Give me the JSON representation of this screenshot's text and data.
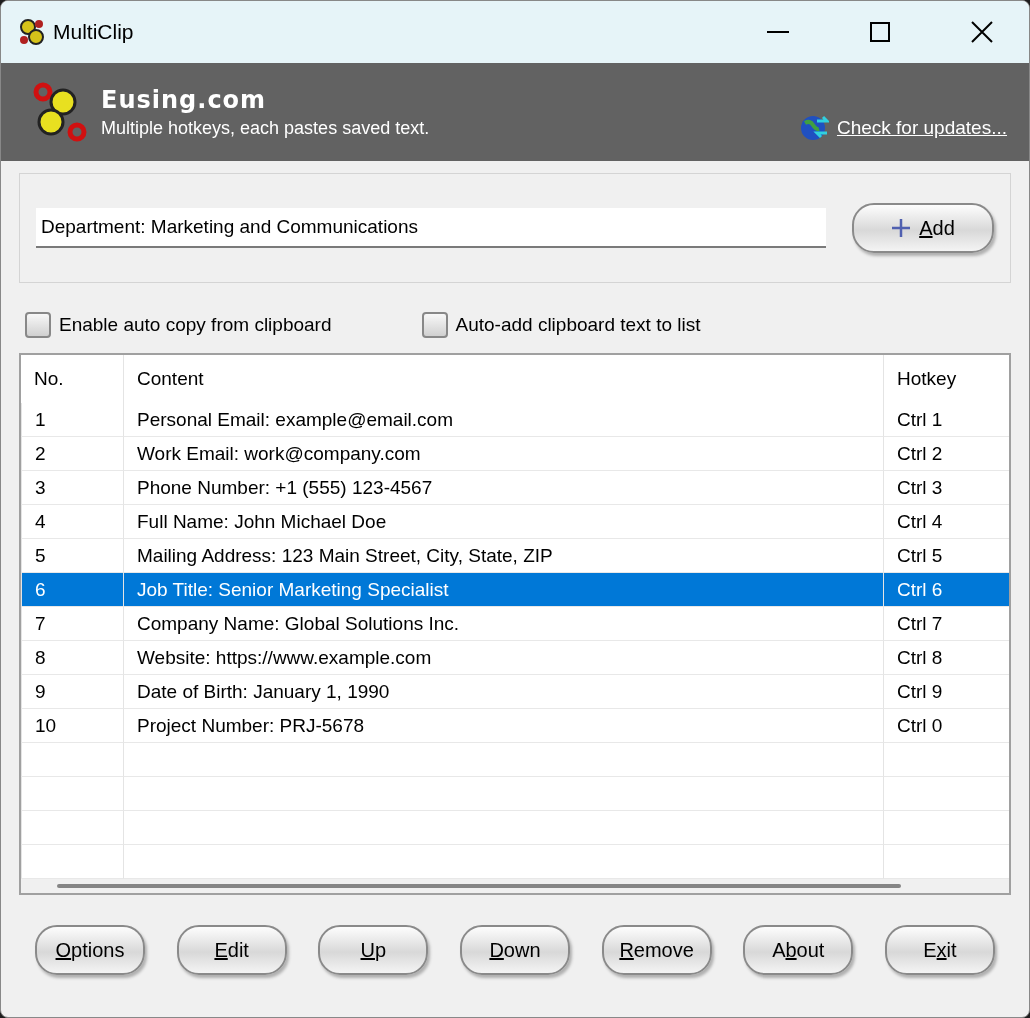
{
  "window": {
    "title": "MultiClip"
  },
  "header": {
    "title": "Eusing.com",
    "subtitle": "Multiple hotkeys, each pastes saved text.",
    "link": "Check for updates..."
  },
  "input": {
    "value": "Department: Marketing and Communications"
  },
  "add_button": {
    "label": {
      "key": "A",
      "rest": "dd"
    }
  },
  "options": [
    {
      "label": "Enable auto copy from clipboard",
      "checked": false
    },
    {
      "label": "Auto-add clipboard text to list",
      "checked": false
    }
  ],
  "table": {
    "columns": [
      "No.",
      "Content",
      "Hotkey"
    ],
    "rows": [
      {
        "cells": [
          "1",
          "Personal Email: example@email.com",
          "Ctrl 1"
        ],
        "selected": false
      },
      {
        "cells": [
          "2",
          "Work Email: work@company.com",
          "Ctrl 2"
        ],
        "selected": false
      },
      {
        "cells": [
          "3",
          "Phone Number: +1 (555) 123-4567",
          "Ctrl 3"
        ],
        "selected": false
      },
      {
        "cells": [
          "4",
          "Full Name: John Michael Doe",
          "Ctrl 4"
        ],
        "selected": false
      },
      {
        "cells": [
          "5",
          "Mailing Address: 123 Main Street, City, State, ZIP",
          "Ctrl 5"
        ],
        "selected": false
      },
      {
        "cells": [
          "6",
          "Job Title: Senior Marketing Specialist",
          "Ctrl 6"
        ],
        "selected": true
      },
      {
        "cells": [
          "7",
          "Company Name: Global Solutions Inc.",
          "Ctrl 7"
        ],
        "selected": false
      },
      {
        "cells": [
          "8",
          "Website: https://www.example.com",
          "Ctrl 8"
        ],
        "selected": false
      },
      {
        "cells": [
          "9",
          "Date of Birth: January 1, 1990",
          "Ctrl 9"
        ],
        "selected": false
      },
      {
        "cells": [
          "10",
          "Project Number: PRJ-5678",
          "Ctrl 0"
        ],
        "selected": false
      }
    ]
  },
  "buttons": [
    {
      "label": {
        "key": "O",
        "rest": "ptions"
      }
    },
    {
      "label": {
        "key": "E",
        "rest": "dit"
      }
    },
    {
      "label": {
        "key": "U",
        "rest": "p"
      }
    },
    {
      "label": {
        "key": "D",
        "rest": "own"
      }
    },
    {
      "label": {
        "key": "R",
        "rest": "emove"
      }
    },
    {
      "label": {
        "lead": "A",
        "key": "b",
        "rest": "out"
      }
    },
    {
      "label": {
        "lead": "E",
        "key": "x",
        "rest": "it"
      }
    }
  ]
}
